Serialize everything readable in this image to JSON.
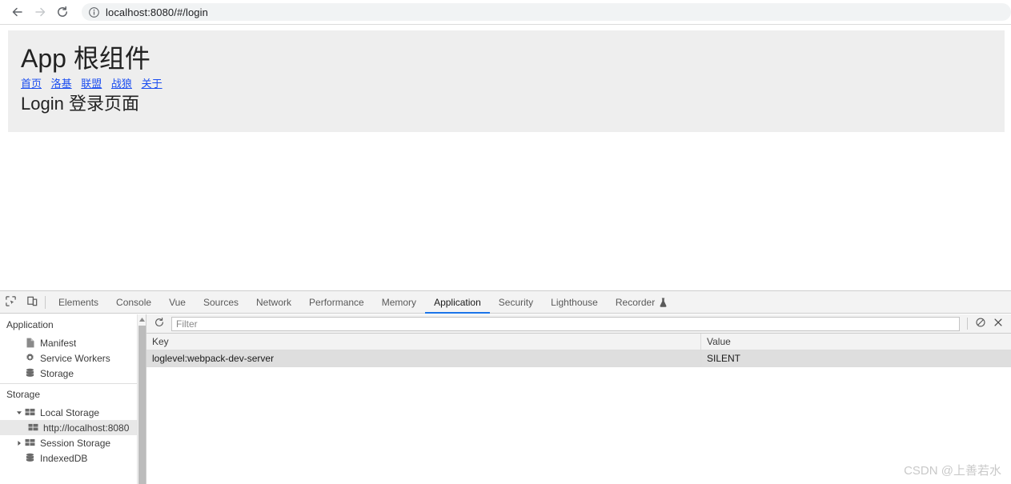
{
  "browser": {
    "back_icon": "back-arrow-icon",
    "forward_icon": "forward-arrow-icon",
    "reload_icon": "reload-icon",
    "site_info_icon": "info-circle-icon",
    "url": "localhost:8080/#/login"
  },
  "page": {
    "app_title": "App 根组件",
    "nav_links": [
      {
        "label": "首页"
      },
      {
        "label": "洛基"
      },
      {
        "label": "联盟"
      },
      {
        "label": "战狼"
      },
      {
        "label": "关于"
      }
    ],
    "route_heading": "Login 登录页面",
    "panel_bg": "#eeeeee",
    "link_color": "#1a4df0"
  },
  "devtools": {
    "inspect_icon": "inspect-element-icon",
    "device_toolbar_icon": "device-toolbar-icon",
    "tabs": [
      {
        "label": "Elements",
        "active": false
      },
      {
        "label": "Console",
        "active": false
      },
      {
        "label": "Vue",
        "active": false
      },
      {
        "label": "Sources",
        "active": false
      },
      {
        "label": "Network",
        "active": false
      },
      {
        "label": "Performance",
        "active": false
      },
      {
        "label": "Memory",
        "active": false
      },
      {
        "label": "Application",
        "active": true
      },
      {
        "label": "Security",
        "active": false
      },
      {
        "label": "Lighthouse",
        "active": false
      },
      {
        "label": "Recorder",
        "active": false,
        "icon": "flask-icon"
      }
    ],
    "active_tab_color": "#1a73e8",
    "sidebar": {
      "section_application": "Application",
      "application_items": [
        {
          "label": "Manifest",
          "icon": "document-icon"
        },
        {
          "label": "Service Workers",
          "icon": "gear-icon"
        },
        {
          "label": "Storage",
          "icon": "database-icon"
        }
      ],
      "section_storage": "Storage",
      "storage_items": [
        {
          "label": "Local Storage",
          "icon": "table-icon",
          "twisty": "expanded",
          "selected": false
        },
        {
          "label": "http://localhost:8080",
          "icon": "table-icon",
          "twisty": "none",
          "selected": true
        },
        {
          "label": "Session Storage",
          "icon": "table-icon",
          "twisty": "collapsed",
          "selected": false
        },
        {
          "label": "IndexedDB",
          "icon": "database-icon",
          "twisty": "none",
          "selected": false
        }
      ]
    },
    "toolbar": {
      "refresh_icon": "refresh-icon",
      "filter_placeholder": "Filter",
      "filter_value": "",
      "clear_all_icon": "clear-all-circle-slash-icon",
      "delete_selected_icon": "delete-x-icon"
    },
    "table": {
      "columns": [
        "Key",
        "Value"
      ],
      "rows": [
        {
          "key": "loglevel:webpack-dev-server",
          "value": "SILENT",
          "selected": true
        }
      ]
    }
  },
  "watermark": {
    "text": "CSDN @上善若水"
  }
}
